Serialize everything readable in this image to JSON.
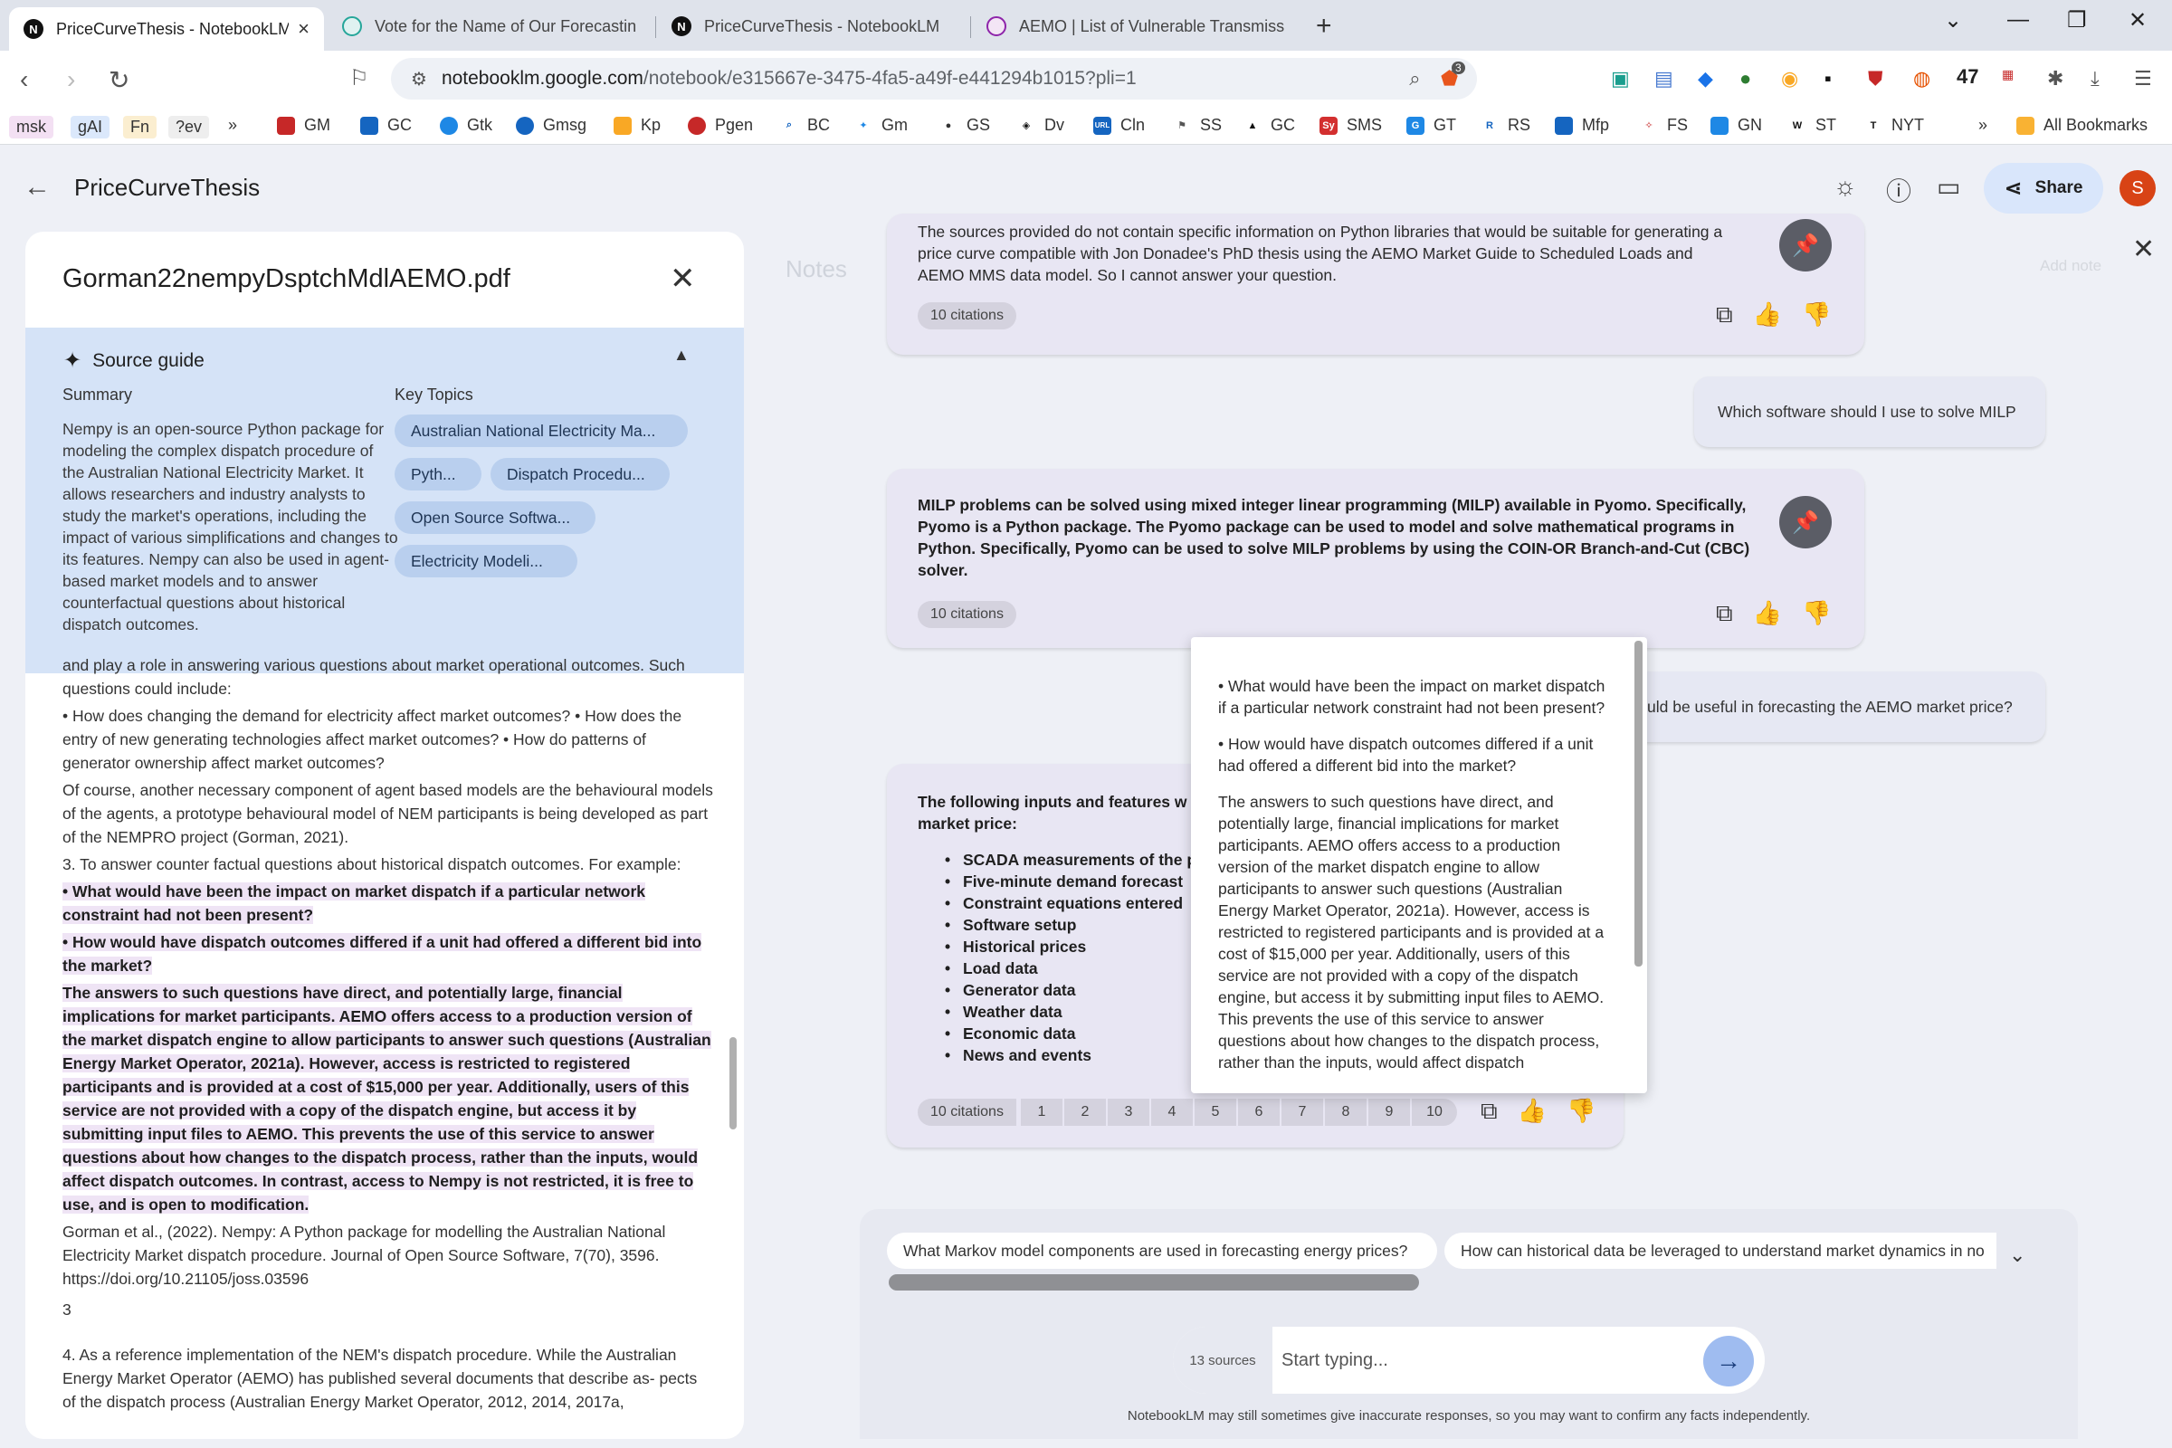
{
  "browser": {
    "tabs": [
      {
        "title": "PriceCurveThesis - NotebookLM",
        "active": true,
        "favicon": "N"
      },
      {
        "title": "Vote for the Name of Our Forecastin",
        "active": false,
        "favicon": "vote-icon"
      },
      {
        "title": "PriceCurveThesis - NotebookLM",
        "active": false,
        "favicon": "N"
      },
      {
        "title": "AEMO | List of Vulnerable Transmissi",
        "active": false,
        "favicon": "aemo-icon"
      }
    ],
    "tab_close": "×",
    "new_tab": "+",
    "url_host": "notebooklm.google.com",
    "url_path": "/notebook/e315667e-3475-4fa5-a49f-e441294b1015?pli=1",
    "extension_count": "47",
    "badge_count": "3",
    "bookmarks": [
      "msk",
      "gAI",
      "Fn",
      "?ev",
      "»",
      "GM",
      "GC",
      "Gtk",
      "Gmsg",
      "Kp",
      "Pgen",
      "BC",
      "Gm",
      "GS",
      "Dv",
      "Cln",
      "SS",
      "GC",
      "SMS",
      "GT",
      "RS",
      "Mfp",
      "FS",
      "GN",
      "ST",
      "NYT",
      "»",
      "All Bookmarks"
    ]
  },
  "header": {
    "title": "PriceCurveThesis",
    "share_label": "Share",
    "avatar_initial": "S"
  },
  "source_panel": {
    "file_title": "Gorman22nempyDsptchMdlAEMO.pdf",
    "guide_label": "Source guide",
    "summary_heading": "Summary",
    "topics_heading": "Key Topics",
    "summary": "Nempy is an open-source Python package for modeling the complex dispatch procedure of the Australian National Electricity Market. It allows researchers and industry analysts to study the market's operations, including the impact of various simplifications and changes to its features. Nempy can also be used in agent-based market models and to answer counterfactual questions about historical dispatch outcomes.",
    "topics": [
      "Australian National Electricity Ma...",
      "Pyth...",
      "Dispatch Procedu...",
      "Open Source Softwa...",
      "Electricity Modeli..."
    ],
    "doc": {
      "p0": "and play a role in answering various questions about market operational outcomes. Such questions could include:",
      "p1": "• How does changing the demand for electricity affect market outcomes? • How does the entry of new generating technologies affect market outcomes? • How do patterns of generator ownership affect market outcomes?",
      "p2": "Of course, another necessary component of agent based models are the behavioural models of the agents, a prototype behavioural model of NEM participants is being developed as part of the NEMPRO project (Gorman, 2021).",
      "p3": "3. To answer counter factual questions about historical dispatch outcomes. For example:",
      "h1": "• What would have been the impact on market dispatch if a particular network constraint had not been present?",
      "h2": "• How would have dispatch outcomes differed if a unit had offered a different bid into the market?",
      "h3": "The answers to such questions have direct, and potentially large, financial implications for market participants. AEMO offers access to a production version of the market dispatch engine to allow participants to answer such questions (Australian Energy Market Operator, 2021a). However, access is restricted to registered participants and is provided at a cost of $15,000 per year. Additionally, users of this service are not provided with a copy of the dispatch engine, but access it by submitting input files to AEMO. This prevents the use of this service to answer questions about how changes to the dispatch process, rather than the inputs, would affect dispatch outcomes. In contrast, access to Nempy is not restricted, it is free to use, and is open to modification.",
      "p4": "Gorman et al., (2022). Nempy: A Python package for modelling the Australian National Electricity Market dispatch procedure. Journal of Open Source Software, 7(70), 3596. https://doi.org/10.21105/joss.03596",
      "p5": "3",
      "p6": "4. As a reference implementation of the NEM's dispatch procedure. While the Australian Energy Market Operator (AEMO) has published several documents that describe as- pects of the dispatch process (Australian Energy Market Operator, 2012, 2014, 2017a,"
    }
  },
  "notes": {
    "label": "Notes",
    "add_note": "Add note"
  },
  "chat": {
    "response1": "The sources provided do not contain specific information on Python libraries that would be suitable for generating a price curve compatible with Jon Donadee's PhD thesis using the AEMO Market Guide to Scheduled Loads and AEMO MMS data model. So I cannot answer your question.",
    "response1_citations": "10 citations",
    "user1": "Which software should I use to solve MILP",
    "response2": "MILP problems can be solved using mixed integer linear programming (MILP) available in Pyomo. Specifically, Pyomo is a Python package. The Pyomo package can be used to model and solve mathematical programs in Python. Specifically, Pyomo can be used to solve MILP problems by using the COIN-OR Branch-and-Cut (CBC) solver.",
    "response2_citations": "10 citations",
    "user2": "uld be useful in forecasting the AEMO market price?",
    "response3_intro": "The following inputs and features w",
    "response3_intro2": "market price:",
    "response3_items": [
      "SCADA measurements of the p",
      "Five-minute demand forecast",
      "Constraint equations entered",
      "Software setup",
      "Historical prices",
      "Load data",
      "Generator data",
      "Weather data",
      "Economic data",
      "News and events"
    ],
    "response3_citations": "10 citations",
    "citation_numbers": [
      "1",
      "2",
      "3",
      "4",
      "5",
      "6",
      "7",
      "8",
      "9",
      "10"
    ],
    "popup": {
      "q1": "• What would have been the impact on market dispatch if a particular network constraint had not been present?",
      "q2": "• How would have dispatch outcomes differed if a unit had offered a different bid into the market?",
      "body": "The answers to such questions have direct, and potentially large, financial implications for market participants. AEMO offers access to a production version of the market dispatch engine to allow participants to answer such questions (Australian Energy Market Operator, 2021a). However, access is restricted to registered participants and is provided at a cost of $15,000 per year. Additionally, users of this service are not provided with a copy of the dispatch engine, but access it by submitting input files to AEMO. This prevents the use of this service to answer questions about how changes to the dispatch process, rather than the inputs, would affect dispatch"
    },
    "suggestions": [
      "What Markov model components are used in forecasting energy prices?",
      "How can historical data be leveraged to understand market dynamics in no"
    ],
    "source_count": "13 sources",
    "input_placeholder": "Start typing...",
    "disclaimer": "NotebookLM may still sometimes give inaccurate responses, so you may want to confirm any facts independently."
  },
  "colors": {
    "accent": "#d5e3f7",
    "chip": "#b9cfee",
    "bubble": "#e8e6f3",
    "highlight": "#efe4f5",
    "avatar": "#d84315"
  }
}
